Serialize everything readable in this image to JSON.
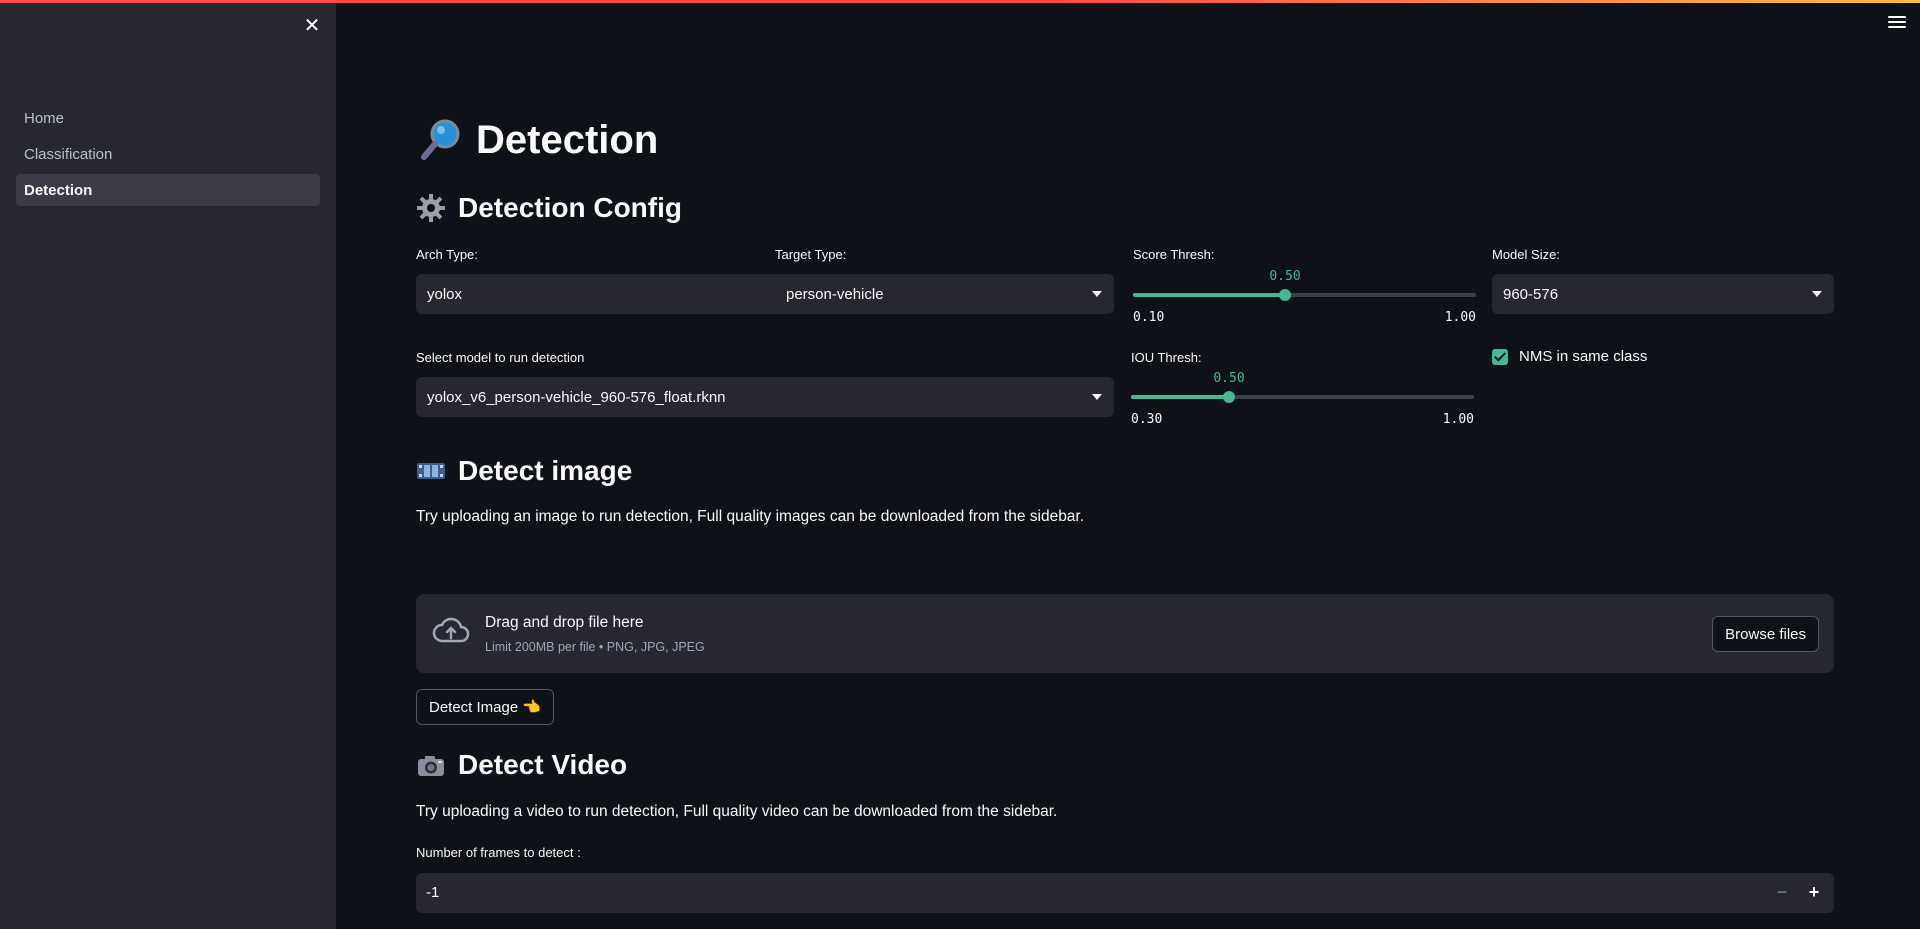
{
  "sidebar": {
    "close_icon": "close-icon",
    "items": [
      {
        "label": "Home"
      },
      {
        "label": "Classification"
      },
      {
        "label": "Detection"
      }
    ]
  },
  "main": {
    "title": "Detection",
    "title_icon": "magnifier-icon",
    "config": {
      "heading": "Detection Config",
      "heading_icon": "gear-icon",
      "arch_type": {
        "label": "Arch Type:",
        "value": "yolox"
      },
      "target_type": {
        "label": "Target Type:",
        "value": "person-vehicle"
      },
      "score_thresh": {
        "label": "Score Thresh:",
        "value": "0.50",
        "min": "0.10",
        "max": "1.00"
      },
      "model_size": {
        "label": "Model Size:",
        "value": "960-576"
      },
      "model_select": {
        "label": "Select model to run detection",
        "value": "yolox_v6_person-vehicle_960-576_float.rknn"
      },
      "iou_thresh": {
        "label": "IOU Thresh:",
        "value": "0.50",
        "min": "0.30",
        "max": "1.00"
      },
      "nms_checkbox": {
        "label": "NMS in same class",
        "checked": true
      }
    },
    "detect_image": {
      "heading": "Detect image",
      "heading_icon": "film-icon",
      "description": "Try uploading an image to run detection, Full quality images can be downloaded from the sidebar.",
      "dropzone_title": "Drag and drop file here",
      "dropzone_limit": "Limit 200MB per file • PNG, JPG, JPEG",
      "browse_label": "Browse files",
      "detect_button": "Detect Image 👈"
    },
    "detect_video": {
      "heading": "Detect Video",
      "heading_icon": "camera-icon",
      "description": "Try uploading a video to run detection, Full quality video can be downloaded from the sidebar.",
      "frames_label": "Number of frames to detect :",
      "frames_value": "-1"
    }
  },
  "colors": {
    "accent": "#48b892",
    "sidebar_bg": "#262730",
    "main_bg": "#0e1117"
  }
}
